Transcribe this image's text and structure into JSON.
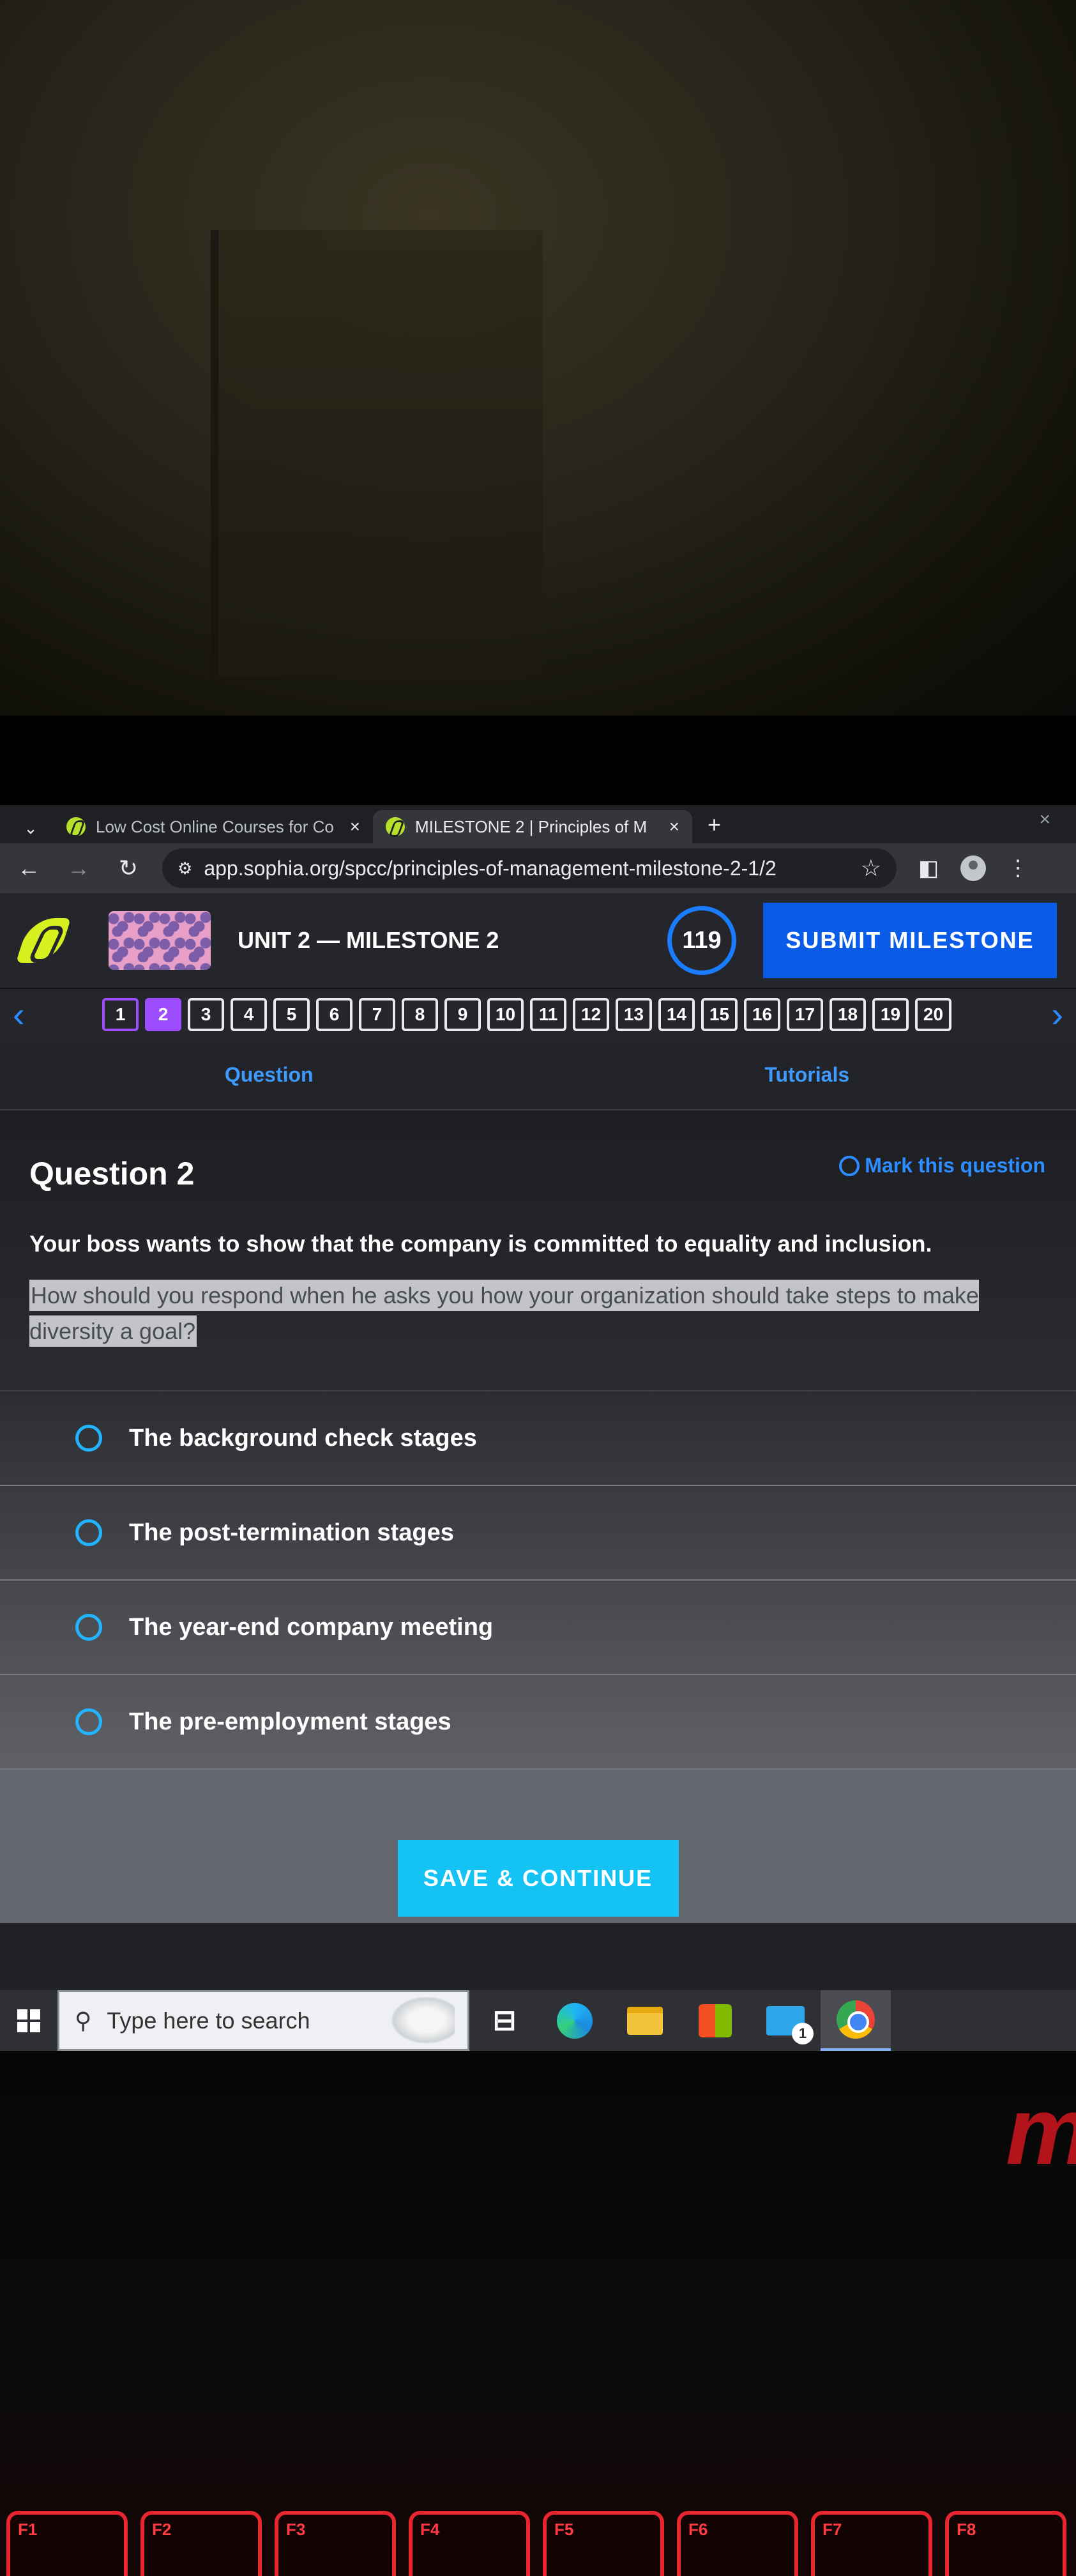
{
  "browser": {
    "tabs": [
      {
        "title": "Low Cost Online Courses for Co",
        "active": false
      },
      {
        "title": "MILESTONE 2 | Principles of M",
        "active": true
      }
    ],
    "new_tab": "+",
    "close_glyph": "×",
    "url": "app.sophia.org/spcc/principles-of-management-milestone-2-1/2"
  },
  "header": {
    "unit_title": "UNIT 2 — MILESTONE 2",
    "counter": "119",
    "submit_label": "SUBMIT MILESTONE"
  },
  "question_nav": {
    "numbers": [
      "1",
      "2",
      "3",
      "4",
      "5",
      "6",
      "7",
      "8",
      "9",
      "10",
      "11",
      "12",
      "13",
      "14",
      "15",
      "16",
      "17",
      "18",
      "19",
      "20"
    ],
    "current": 2
  },
  "tabs": {
    "question": "Question",
    "tutorials": "Tutorials"
  },
  "question": {
    "title": "Question 2",
    "mark_label": "Mark this question",
    "lead": "Your boss wants to show that the company is committed to equality and inclusion.",
    "prompt": "How should you respond when he asks you how your organization should take steps to make diversity a goal?"
  },
  "options": [
    "The background check stages",
    "The post-termination stages",
    "The year-end company meeting",
    "The pre-employment stages"
  ],
  "save_label": "SAVE & CONTINUE",
  "taskbar": {
    "search_placeholder": "Type here to search",
    "mail_badge": "1"
  },
  "keyboard": {
    "fkeys": [
      "F1",
      "F2",
      "F3",
      "F4",
      "F5",
      "F6",
      "F7",
      "F8"
    ]
  },
  "colors": {
    "accent_blue": "#0a5be8",
    "link_blue": "#2d8cff",
    "save_cyan": "#14c3f3",
    "answered_purple": "#9b4dff",
    "logo_lime": "#d7f01f"
  }
}
